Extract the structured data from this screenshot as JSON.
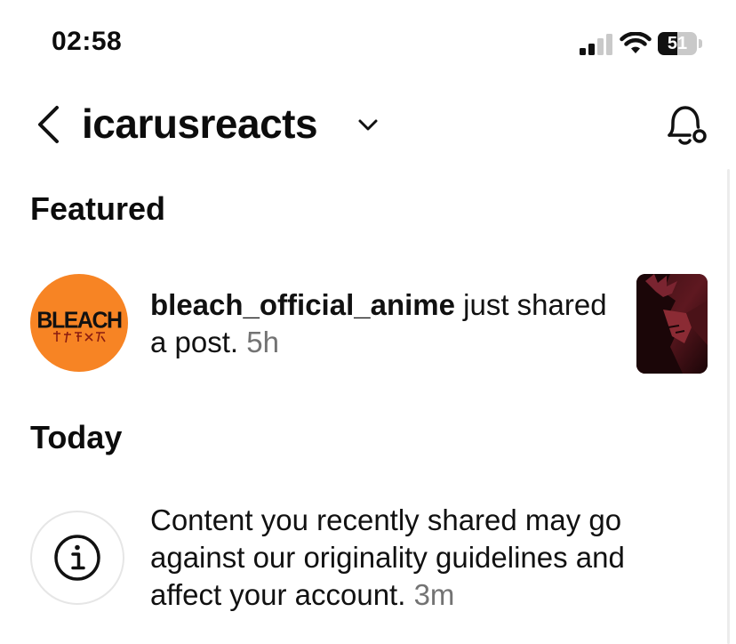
{
  "status_bar": {
    "time": "02:58",
    "battery_level": "51",
    "battery_fraction": 0.51,
    "signal_bars_active": 2,
    "signal_bars_total": 4
  },
  "header": {
    "username": "icarusreacts",
    "back_icon": "chevron-left-icon",
    "dropdown_icon": "chevron-down-icon",
    "notification_settings_icon": "bell-settings-icon"
  },
  "sections": {
    "featured": {
      "title": "Featured",
      "item": {
        "avatar_text": "BLEACH",
        "user": "bleach_official_anime",
        "message": " just shared a post. ",
        "time": "5h"
      }
    },
    "today": {
      "title": "Today",
      "item": {
        "icon": "info-icon",
        "message": "Content you recently shared may go against our originality guidelines and affect your account. ",
        "time": "3m"
      }
    }
  },
  "colors": {
    "bleach_orange": "#f78424",
    "timestamp_gray": "#737373",
    "text": "#0c0c0c"
  }
}
